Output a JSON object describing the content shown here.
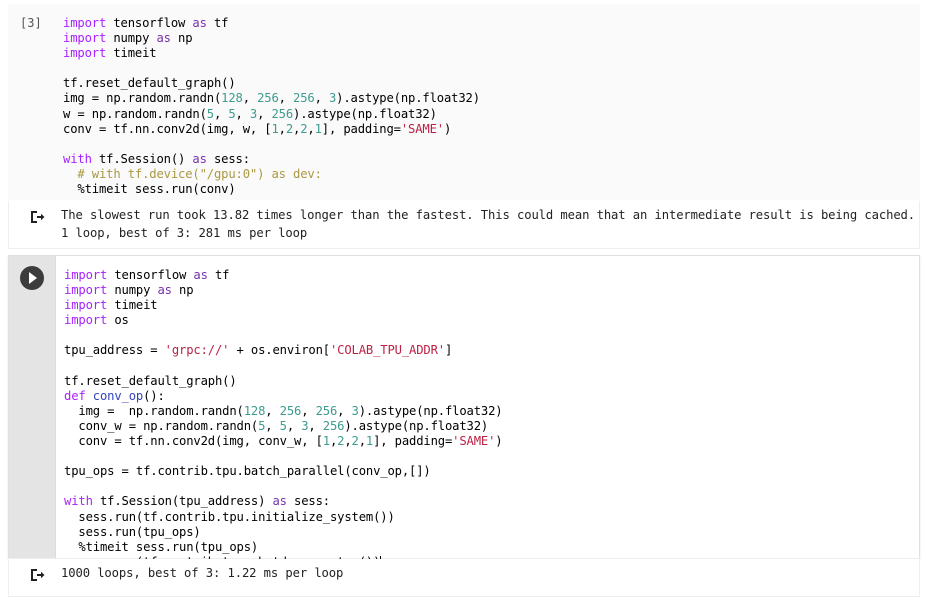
{
  "notebook": {
    "cells": [
      {
        "id": "cell-1",
        "execution_label": "[3]",
        "state": "executed",
        "code_lines": [
          [
            {
              "t": "import",
              "c": "kw"
            },
            {
              "t": " tensorflow ",
              "c": "plain"
            },
            {
              "t": "as",
              "c": "kw2"
            },
            {
              "t": " tf",
              "c": "plain"
            }
          ],
          [
            {
              "t": "import",
              "c": "kw"
            },
            {
              "t": " numpy ",
              "c": "plain"
            },
            {
              "t": "as",
              "c": "kw2"
            },
            {
              "t": " np",
              "c": "plain"
            }
          ],
          [
            {
              "t": "import",
              "c": "kw"
            },
            {
              "t": " timeit",
              "c": "plain"
            }
          ],
          [
            {
              "t": "",
              "c": "plain"
            }
          ],
          [
            {
              "t": "tf.reset_default_graph()",
              "c": "plain"
            }
          ],
          [
            {
              "t": "img = np.random.randn(",
              "c": "plain"
            },
            {
              "t": "128",
              "c": "num"
            },
            {
              "t": ", ",
              "c": "plain"
            },
            {
              "t": "256",
              "c": "num"
            },
            {
              "t": ", ",
              "c": "plain"
            },
            {
              "t": "256",
              "c": "num"
            },
            {
              "t": ", ",
              "c": "plain"
            },
            {
              "t": "3",
              "c": "num"
            },
            {
              "t": ").astype(np.float32)",
              "c": "plain"
            }
          ],
          [
            {
              "t": "w = np.random.randn(",
              "c": "plain"
            },
            {
              "t": "5",
              "c": "num"
            },
            {
              "t": ", ",
              "c": "plain"
            },
            {
              "t": "5",
              "c": "num"
            },
            {
              "t": ", ",
              "c": "plain"
            },
            {
              "t": "3",
              "c": "num"
            },
            {
              "t": ", ",
              "c": "plain"
            },
            {
              "t": "256",
              "c": "num"
            },
            {
              "t": ").astype(np.float32)",
              "c": "plain"
            }
          ],
          [
            {
              "t": "conv = tf.nn.conv2d(img, w, [",
              "c": "plain"
            },
            {
              "t": "1",
              "c": "num"
            },
            {
              "t": ",",
              "c": "plain"
            },
            {
              "t": "2",
              "c": "num"
            },
            {
              "t": ",",
              "c": "plain"
            },
            {
              "t": "2",
              "c": "num"
            },
            {
              "t": ",",
              "c": "plain"
            },
            {
              "t": "1",
              "c": "num"
            },
            {
              "t": "], padding=",
              "c": "plain"
            },
            {
              "t": "'SAME'",
              "c": "str"
            },
            {
              "t": ")",
              "c": "plain"
            }
          ],
          [
            {
              "t": "",
              "c": "plain"
            }
          ],
          [
            {
              "t": "with",
              "c": "kw"
            },
            {
              "t": " tf.Session() ",
              "c": "plain"
            },
            {
              "t": "as",
              "c": "kw2"
            },
            {
              "t": " sess:",
              "c": "plain"
            }
          ],
          [
            {
              "t": "  # with tf.device(\"/gpu:0\") as dev:",
              "c": "cmt"
            }
          ],
          [
            {
              "t": "  %timeit sess.run(conv)",
              "c": "plain"
            }
          ]
        ],
        "output_icon": "output-arrow-icon",
        "output_lines": [
          "The slowest run took 13.82 times longer than the fastest. This could mean that an intermediate result is being cached.",
          "1 loop, best of 3: 281 ms per loop"
        ]
      },
      {
        "id": "cell-2",
        "execution_label": "",
        "state": "focused",
        "run_button_icon": "play-icon",
        "code_lines": [
          [
            {
              "t": "import",
              "c": "kw"
            },
            {
              "t": " tensorflow ",
              "c": "plain"
            },
            {
              "t": "as",
              "c": "kw2"
            },
            {
              "t": " tf",
              "c": "plain"
            }
          ],
          [
            {
              "t": "import",
              "c": "kw"
            },
            {
              "t": " numpy ",
              "c": "plain"
            },
            {
              "t": "as",
              "c": "kw2"
            },
            {
              "t": " np",
              "c": "plain"
            }
          ],
          [
            {
              "t": "import",
              "c": "kw"
            },
            {
              "t": " timeit",
              "c": "plain"
            }
          ],
          [
            {
              "t": "import",
              "c": "kw"
            },
            {
              "t": " os",
              "c": "plain"
            }
          ],
          [
            {
              "t": "",
              "c": "plain"
            }
          ],
          [
            {
              "t": "tpu_address = ",
              "c": "plain"
            },
            {
              "t": "'grpc://'",
              "c": "str"
            },
            {
              "t": " + os.environ[",
              "c": "plain"
            },
            {
              "t": "'COLAB_TPU_ADDR'",
              "c": "str"
            },
            {
              "t": "]",
              "c": "plain"
            }
          ],
          [
            {
              "t": "",
              "c": "plain"
            }
          ],
          [
            {
              "t": "tf.reset_default_graph()",
              "c": "plain"
            }
          ],
          [
            {
              "t": "def",
              "c": "kw"
            },
            {
              "t": " ",
              "c": "plain"
            },
            {
              "t": "conv_op",
              "c": "fn"
            },
            {
              "t": "():",
              "c": "plain"
            }
          ],
          [
            {
              "t": "  img =  np.random.randn(",
              "c": "plain"
            },
            {
              "t": "128",
              "c": "num"
            },
            {
              "t": ", ",
              "c": "plain"
            },
            {
              "t": "256",
              "c": "num"
            },
            {
              "t": ", ",
              "c": "plain"
            },
            {
              "t": "256",
              "c": "num"
            },
            {
              "t": ", ",
              "c": "plain"
            },
            {
              "t": "3",
              "c": "num"
            },
            {
              "t": ").astype(np.float32)",
              "c": "plain"
            }
          ],
          [
            {
              "t": "  conv_w = np.random.randn(",
              "c": "plain"
            },
            {
              "t": "5",
              "c": "num"
            },
            {
              "t": ", ",
              "c": "plain"
            },
            {
              "t": "5",
              "c": "num"
            },
            {
              "t": ", ",
              "c": "plain"
            },
            {
              "t": "3",
              "c": "num"
            },
            {
              "t": ", ",
              "c": "plain"
            },
            {
              "t": "256",
              "c": "num"
            },
            {
              "t": ").astype(np.float32)",
              "c": "plain"
            }
          ],
          [
            {
              "t": "  conv = tf.nn.conv2d(img, conv_w, [",
              "c": "plain"
            },
            {
              "t": "1",
              "c": "num"
            },
            {
              "t": ",",
              "c": "plain"
            },
            {
              "t": "2",
              "c": "num"
            },
            {
              "t": ",",
              "c": "plain"
            },
            {
              "t": "2",
              "c": "num"
            },
            {
              "t": ",",
              "c": "plain"
            },
            {
              "t": "1",
              "c": "num"
            },
            {
              "t": "], padding=",
              "c": "plain"
            },
            {
              "t": "'SAME'",
              "c": "str"
            },
            {
              "t": ")",
              "c": "plain"
            }
          ],
          [
            {
              "t": "",
              "c": "plain"
            }
          ],
          [
            {
              "t": "tpu_ops = tf.contrib.tpu.batch_parallel(conv_op,[])",
              "c": "plain"
            }
          ],
          [
            {
              "t": "",
              "c": "plain"
            }
          ],
          [
            {
              "t": "with",
              "c": "kw"
            },
            {
              "t": " tf.Session(tpu_address) ",
              "c": "plain"
            },
            {
              "t": "as",
              "c": "kw2"
            },
            {
              "t": " sess:",
              "c": "plain"
            }
          ],
          [
            {
              "t": "  sess.run(tf.contrib.tpu.initialize_system())",
              "c": "plain"
            }
          ],
          [
            {
              "t": "  sess.run(tpu_ops)",
              "c": "plain"
            }
          ],
          [
            {
              "t": "  %timeit sess.run(tpu_ops)",
              "c": "plain"
            }
          ],
          [
            {
              "t": "  sess.run(tf.contrib.tpu.shutdown_system())",
              "c": "plain"
            }
          ]
        ],
        "cursor_line_index": 19,
        "output_icon": "output-arrow-icon",
        "output_lines": [
          "1000 loops, best of 3: 1.22 ms per loop"
        ]
      }
    ]
  },
  "colors": {
    "keyword": "#aa22ff",
    "keyword_alt": "#7733aa",
    "number": "#3e9b8f",
    "string": "#bb2244",
    "comment": "#aa9944",
    "function": "#3344bb",
    "cell_unfocused_bg": "#fafafa",
    "cell_gutter_bg": "#e4e4e4",
    "run_button_bg": "#3c3c3c"
  }
}
